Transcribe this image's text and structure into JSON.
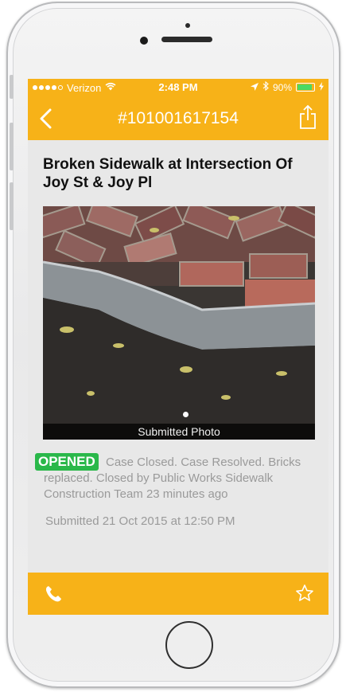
{
  "status_bar": {
    "carrier": "Verizon",
    "time": "2:48 PM",
    "battery": "90%",
    "battery_level": 0.9,
    "icons": [
      "signal-dots-icon",
      "wifi-icon",
      "location-arrow-icon",
      "bluetooth-icon",
      "battery-icon",
      "charging-bolt-icon"
    ]
  },
  "nav": {
    "title": "#101001617154",
    "back_icon": "chevron-left-icon",
    "share_icon": "share-icon"
  },
  "case": {
    "title": "Broken Sidewalk at Intersection Of Joy St & Joy Pl",
    "photo_caption": "Submitted Photo",
    "status_badge": "OPENED",
    "status_text": "Case Closed. Case Resolved. Bricks replaced. Closed by Public Works Sidewalk Construction Team 23 minutes ago",
    "submitted": "Submitted 21 Oct 2015 at 12:50 PM"
  },
  "toolbar": {
    "left_icon": "phone-icon",
    "right_icon": "star-icon"
  },
  "colors": {
    "accent": "#f7b218",
    "status_green": "#2ab84a",
    "background": "#e8e8e8"
  }
}
